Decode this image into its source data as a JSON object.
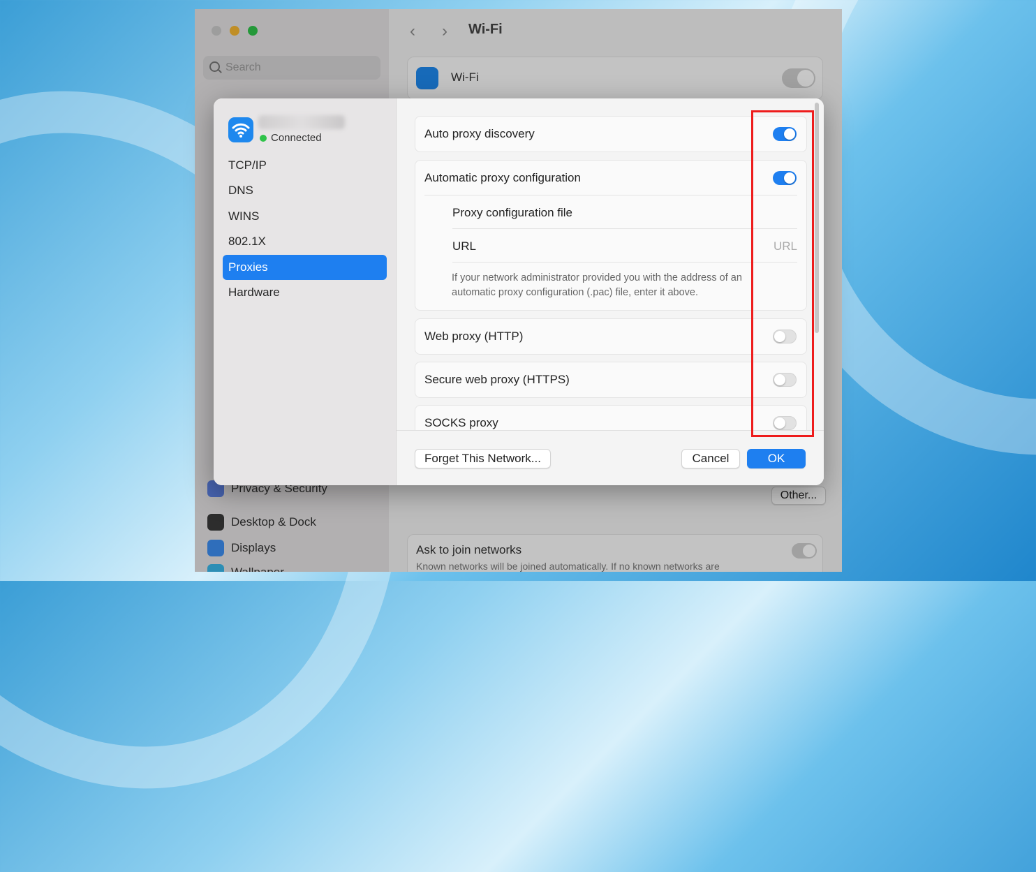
{
  "background_window": {
    "title": "Wi-Fi",
    "search_placeholder": "Search",
    "wifi_row_label": "Wi-Fi",
    "sidebar_items": [
      "Privacy & Security",
      "Desktop & Dock",
      "Displays",
      "Wallpaper"
    ],
    "other_button": "Other...",
    "ask_join_label": "Ask to join networks",
    "ask_join_help": "Known networks will be joined automatically. If no known networks are"
  },
  "dialog": {
    "network": {
      "status": "Connected"
    },
    "nav": [
      "TCP/IP",
      "DNS",
      "WINS",
      "802.1X",
      "Proxies",
      "Hardware"
    ],
    "selected_nav": "Proxies",
    "rows": {
      "auto_proxy_discovery": {
        "label": "Auto proxy discovery",
        "on": true
      },
      "automatic_proxy_configuration": {
        "label": "Automatic proxy configuration",
        "on": true
      },
      "proxy_configuration_file": {
        "label": "Proxy configuration file"
      },
      "url": {
        "label": "URL",
        "placeholder": "URL"
      },
      "help": "If your network administrator provided you with the address of an automatic proxy configuration (.pac) file, enter it above.",
      "web_proxy": {
        "label": "Web proxy (HTTP)",
        "on": false
      },
      "secure_web_proxy": {
        "label": "Secure web proxy (HTTPS)",
        "on": false
      },
      "socks_proxy": {
        "label": "SOCKS proxy",
        "on": false
      }
    },
    "buttons": {
      "forget": "Forget This Network...",
      "cancel": "Cancel",
      "ok": "OK"
    }
  },
  "colors": {
    "accent": "#1e7ff0",
    "highlight_box": "#ee1c1c",
    "connected_dot": "#2fc34a"
  }
}
